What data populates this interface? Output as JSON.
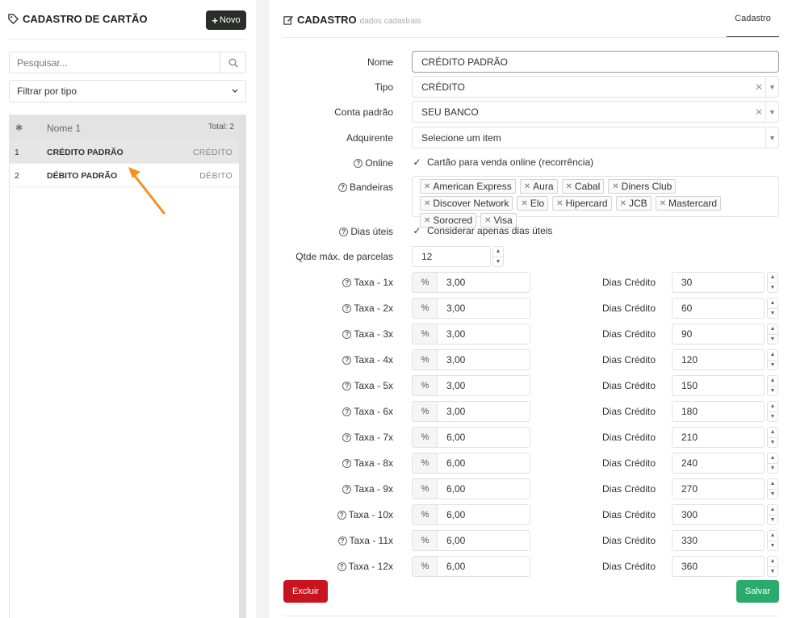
{
  "left": {
    "title": "CADASTRO DE CARTÃO",
    "new_button": "Novo",
    "search_placeholder": "Pesquisar...",
    "filter_label": "Filtrar por tipo",
    "list_header": {
      "name_col": "Nome 1",
      "total": "Total: 2"
    },
    "rows": [
      {
        "idx": "1",
        "name": "CRÉDITO PADRÃO",
        "type": "CRÉDITO"
      },
      {
        "idx": "2",
        "name": "DÉBITO PADRÃO",
        "type": "DÉBITO"
      }
    ]
  },
  "right": {
    "title": "CADASTRO",
    "subtitle": "dados cadastrais",
    "tab": "Cadastro",
    "labels": {
      "nome": "Nome",
      "tipo": "Tipo",
      "conta": "Conta padrão",
      "adquirente": "Adquirente",
      "online": "Online",
      "bandeiras": "Bandeiras",
      "dias_uteis": "Dias úteis",
      "qtde": "Qtde máx. de parcelas",
      "dias_credito": "Dias Crédito"
    },
    "values": {
      "nome": "CRÉDITO PADRÃO",
      "tipo": "CRÉDITO",
      "conta": "SEU BANCO",
      "adquirente_placeholder": "Selecione um item",
      "online_check": "Cartão para venda online (recorrência)",
      "dias_uteis_check": "Considerar apenas dias úteis",
      "qtde": "12"
    },
    "bandeiras": [
      "American Express",
      "Aura",
      "Cabal",
      "Diners Club",
      "Discover Network",
      "Elo",
      "Hipercard",
      "JCB",
      "Mastercard",
      "Sorocred",
      "Visa"
    ],
    "taxas": [
      {
        "label": "Taxa - 1x",
        "rate": "3,00",
        "dias": "30"
      },
      {
        "label": "Taxa - 2x",
        "rate": "3,00",
        "dias": "60"
      },
      {
        "label": "Taxa - 3x",
        "rate": "3,00",
        "dias": "90"
      },
      {
        "label": "Taxa - 4x",
        "rate": "3,00",
        "dias": "120"
      },
      {
        "label": "Taxa - 5x",
        "rate": "3,00",
        "dias": "150"
      },
      {
        "label": "Taxa - 6x",
        "rate": "3,00",
        "dias": "180"
      },
      {
        "label": "Taxa - 7x",
        "rate": "6,00",
        "dias": "210"
      },
      {
        "label": "Taxa - 8x",
        "rate": "6,00",
        "dias": "240"
      },
      {
        "label": "Taxa - 9x",
        "rate": "6,00",
        "dias": "270"
      },
      {
        "label": "Taxa - 10x",
        "rate": "6,00",
        "dias": "300"
      },
      {
        "label": "Taxa - 11x",
        "rate": "6,00",
        "dias": "330"
      },
      {
        "label": "Taxa - 12x",
        "rate": "6,00",
        "dias": "360"
      }
    ],
    "percent_symbol": "%",
    "delete_button": "Excluir",
    "save_button": "Salvar"
  },
  "colors": {
    "delete": "#c8141c",
    "save": "#2bab6b",
    "arrow": "#f5901e",
    "new_button": "#2a2e2b"
  },
  "icons": {
    "tag": "tag-icon",
    "edit": "edit-icon",
    "search": "search-icon",
    "gear": "gear-icon",
    "help": "question-circle-icon",
    "arrow": "arrow-annotation-icon"
  }
}
